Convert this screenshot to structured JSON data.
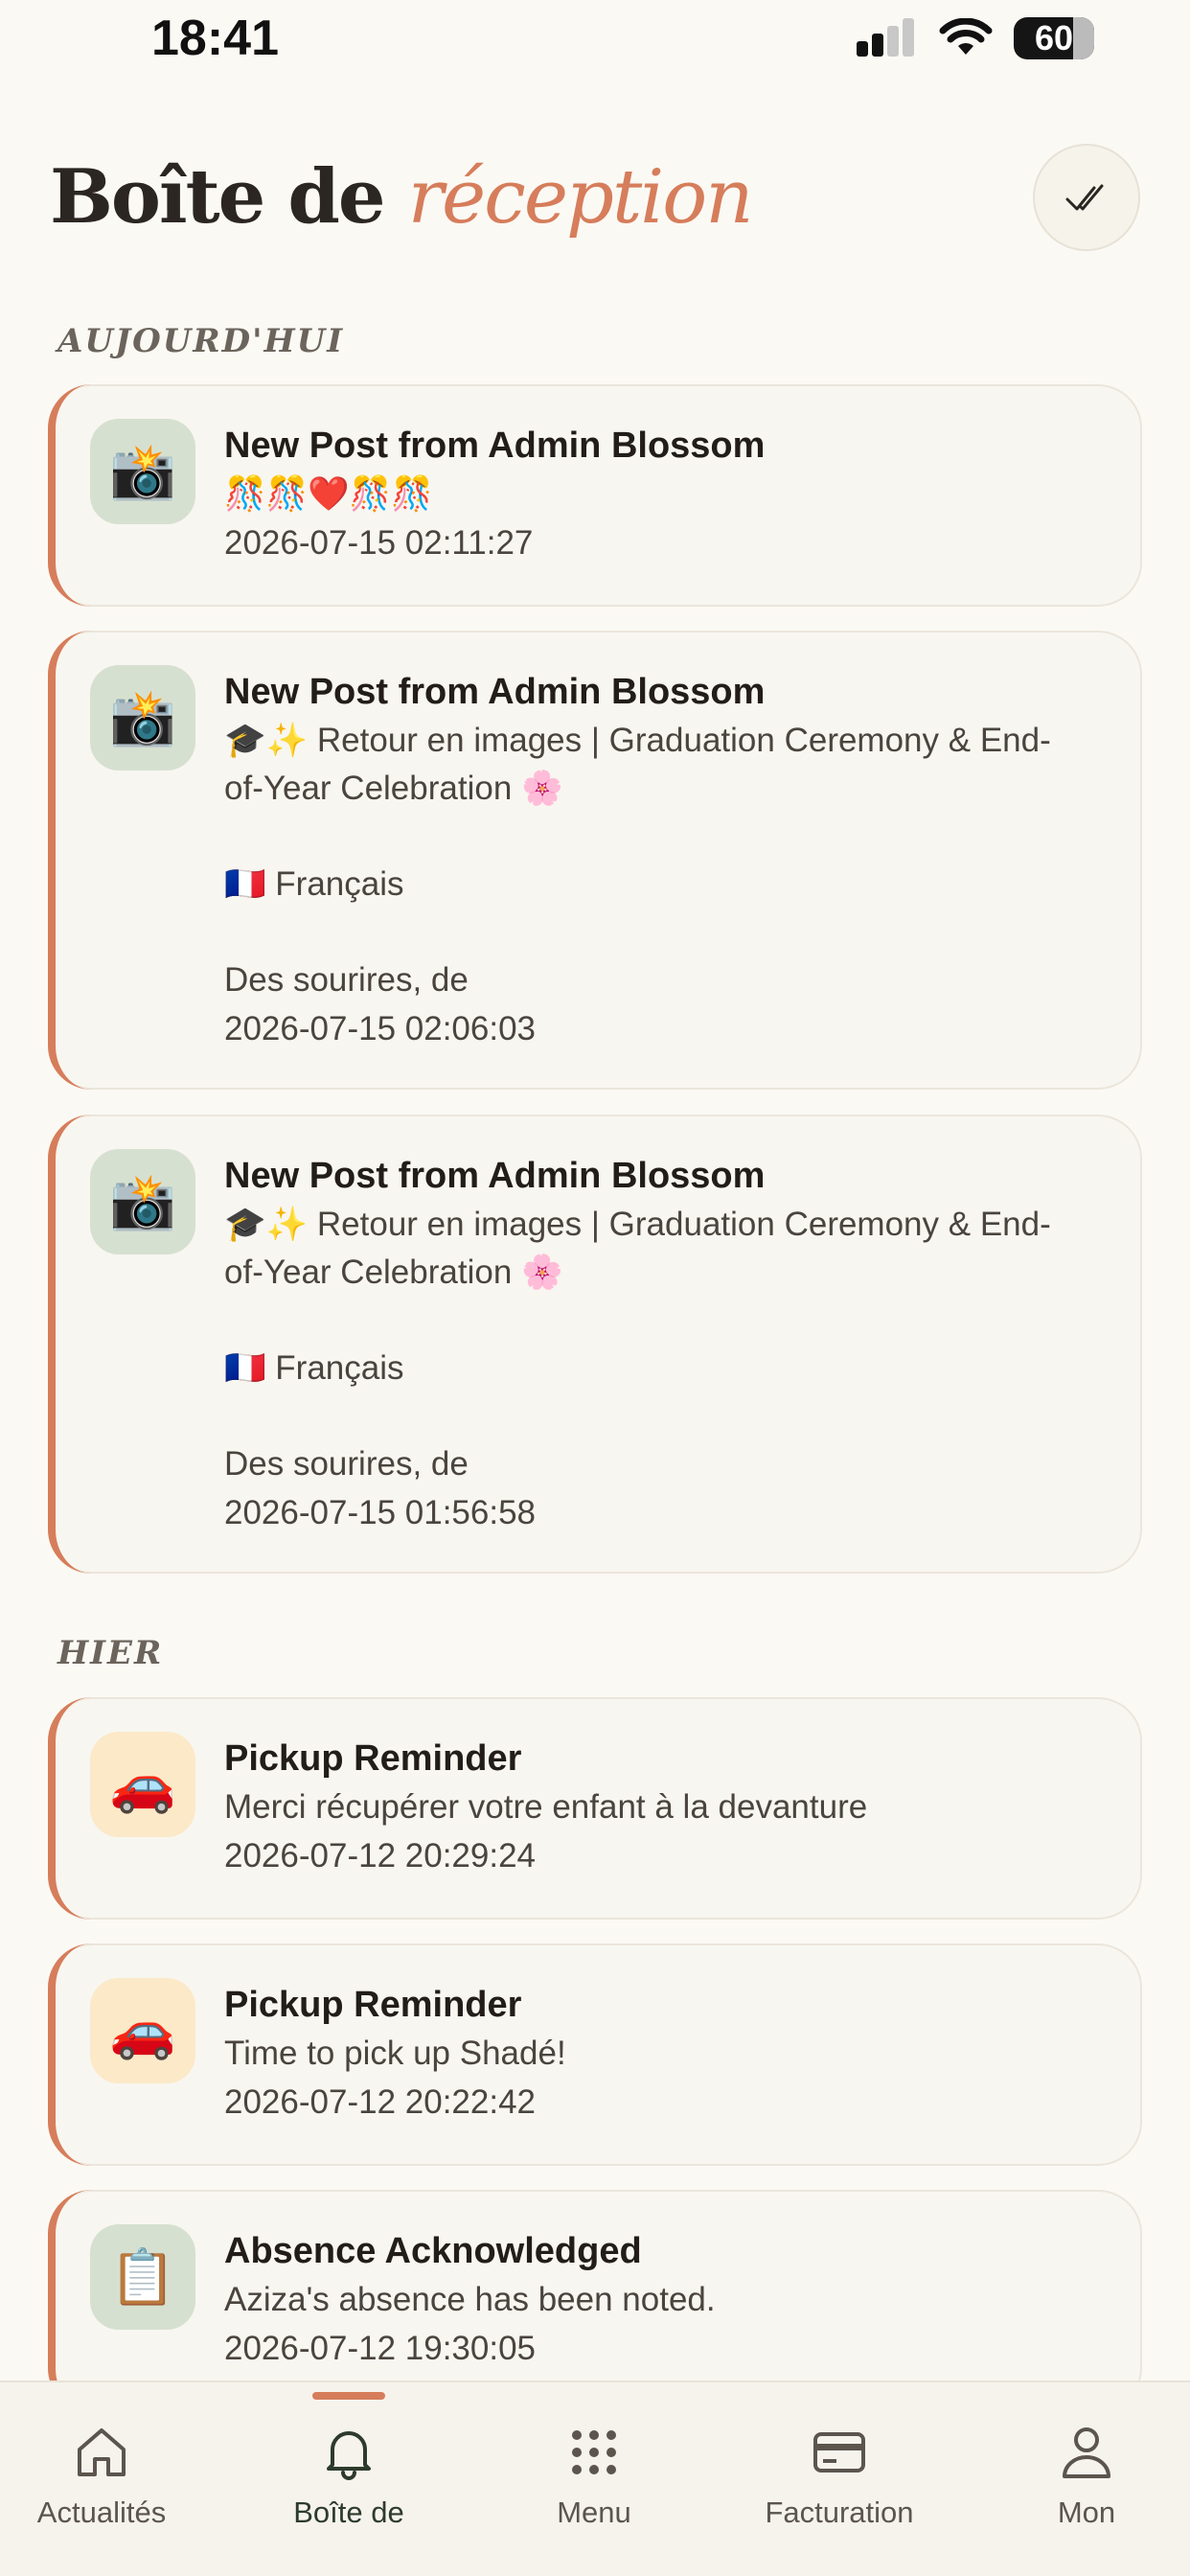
{
  "status_bar": {
    "time": "18:41",
    "battery": "60"
  },
  "header": {
    "title_main": "Boîte de",
    "title_accent": "réception",
    "mark_all_read_icon": "double-check-icon"
  },
  "sections": [
    {
      "label": "AUJOURD'HUI",
      "items": [
        {
          "icon": "camera-flash-icon",
          "emoji": "📸",
          "title": "New Post from Admin Blossom",
          "text": "🎊🎊❤️🎊🎊",
          "date": "2026-07-15 02:11:27"
        },
        {
          "icon": "camera-flash-icon",
          "emoji": "📸",
          "title": "New Post from Admin Blossom",
          "text": "🎓✨ Retour en images | Graduation Ceremony & End-\nof-Year Celebration 🌸\n\n🇫🇷 Français\n\nDes sourires, de",
          "date": "2026-07-15 02:06:03"
        },
        {
          "icon": "camera-flash-icon",
          "emoji": "📸",
          "title": "New Post from Admin Blossom",
          "text": "🎓✨ Retour en images | Graduation Ceremony & End-\nof-Year Celebration 🌸\n\n🇫🇷 Français\n\nDes sourires, de",
          "date": "2026-07-15 01:56:58"
        }
      ]
    },
    {
      "label": "HIER",
      "items": [
        {
          "icon": "car-icon",
          "emoji": "🚗",
          "title": "Pickup Reminder",
          "text": "Merci récupérer votre enfant à la devanture",
          "date": "2026-07-12 20:29:24"
        },
        {
          "icon": "car-icon",
          "emoji": "🚗",
          "title": "Pickup Reminder",
          "text": "Time to pick up Shadé!",
          "date": "2026-07-12 20:22:42"
        },
        {
          "icon": "clipboard-icon",
          "emoji": "📋",
          "title": "Absence Acknowledged",
          "text": "Aziza's absence has been noted.",
          "date": "2026-07-12 19:30:05"
        }
      ]
    }
  ],
  "tabs": [
    {
      "label": "Actualités",
      "icon": "home-icon"
    },
    {
      "label": "Boîte de",
      "icon": "bell-icon",
      "active": true
    },
    {
      "label": "Menu",
      "icon": "grid-icon"
    },
    {
      "label": "Facturation",
      "icon": "card-icon"
    },
    {
      "label": "Mon",
      "icon": "person-icon"
    }
  ],
  "colors": {
    "accent": "#d67d5b",
    "background": "#fbf9f4",
    "card": "#f8f6f0",
    "active_tab": "#2d3b2c"
  }
}
